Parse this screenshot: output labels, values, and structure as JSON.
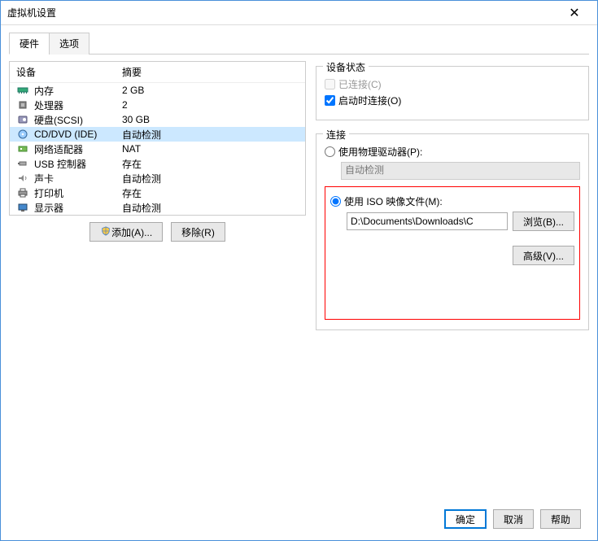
{
  "window": {
    "title": "虚拟机设置"
  },
  "tabs": {
    "hardware": "硬件",
    "options": "选项"
  },
  "columns": {
    "device": "设备",
    "summary": "摘要"
  },
  "devices": [
    {
      "name": "内存",
      "summary": "2 GB",
      "icon": "memory"
    },
    {
      "name": "处理器",
      "summary": "2",
      "icon": "cpu"
    },
    {
      "name": "硬盘(SCSI)",
      "summary": "30 GB",
      "icon": "disk"
    },
    {
      "name": "CD/DVD (IDE)",
      "summary": "自动检测",
      "icon": "cd",
      "selected": true
    },
    {
      "name": "网络适配器",
      "summary": "NAT",
      "icon": "net"
    },
    {
      "name": "USB 控制器",
      "summary": "存在",
      "icon": "usb"
    },
    {
      "name": "声卡",
      "summary": "自动检测",
      "icon": "sound"
    },
    {
      "name": "打印机",
      "summary": "存在",
      "icon": "printer"
    },
    {
      "name": "显示器",
      "summary": "自动检测",
      "icon": "display"
    }
  ],
  "deviceStatus": {
    "legend": "设备状态",
    "connected": "已连接(C)",
    "connectOnPower": "启动时连接(O)"
  },
  "connection": {
    "legend": "连接",
    "usePhysical": "使用物理驱动器(P):",
    "autoDetect": "自动检测",
    "useIso": "使用 ISO 映像文件(M):",
    "isoPath": "D:\\Documents\\Downloads\\C",
    "browse": "浏览(B)...",
    "advanced": "高级(V)..."
  },
  "leftFooter": {
    "add": "添加(A)...",
    "remove": "移除(R)"
  },
  "footer": {
    "ok": "确定",
    "cancel": "取消",
    "help": "帮助"
  }
}
